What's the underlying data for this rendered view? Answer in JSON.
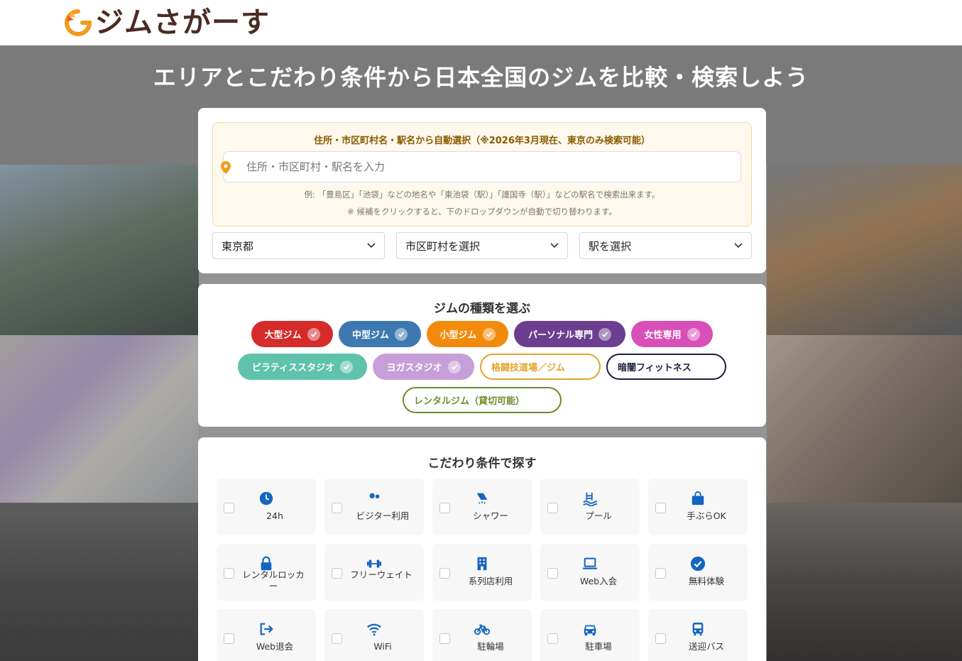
{
  "header": {
    "logo_text": "ジムさがーす"
  },
  "hero": {
    "title": "エリアとこだわり条件から日本全国のジムを比較・検索しよう"
  },
  "search": {
    "auto_title": "住所・市区町村名・駅名から自動選択（※2026年3月現在、東京のみ検索可能）",
    "input_placeholder": "住所・市区町村・駅名を入力",
    "note1": "例: 「豊島区」「池袋」などの地名や「東池袋（駅）」「護国寺（駅）」などの駅名で検索出来ます。",
    "note2": "※ 候補をクリックすると、下のドロップダウンが自動で切り替わります。",
    "prefecture": "東京都",
    "city": "市区町村を選択",
    "station": "駅を選択"
  },
  "types": {
    "title": "ジムの種類を選ぶ",
    "chips": [
      {
        "label": "大型ジム",
        "color": "#d62b2b",
        "checked": true
      },
      {
        "label": "中型ジム",
        "color": "#3d79b0",
        "checked": true
      },
      {
        "label": "小型ジム",
        "color": "#f28a0c",
        "checked": true
      },
      {
        "label": "パーソナル専門",
        "color": "#6c3e8f",
        "checked": true
      },
      {
        "label": "女性専用",
        "color": "#d94fb8",
        "checked": true
      },
      {
        "label": "ピラティススタジオ",
        "color": "#5ec3aa",
        "checked": true
      },
      {
        "label": "ヨガスタジオ",
        "color": "#c79fd8",
        "checked": true
      },
      {
        "label": "格闘技道場／ジム",
        "color": "#e3a42a",
        "checked": false
      },
      {
        "label": "暗闇フィットネス",
        "color": "#1c1f3a",
        "checked": false
      },
      {
        "label": "レンタルジム（貸切可能）",
        "color": "#6e8a2c",
        "checked": false
      }
    ]
  },
  "conditions": {
    "title": "こだわり条件で探す",
    "icon_color": "#1565c0",
    "items": [
      {
        "label": "24h",
        "icon": "clock-icon"
      },
      {
        "label": "ビジター利用",
        "icon": "users-icon"
      },
      {
        "label": "シャワー",
        "icon": "shower-icon"
      },
      {
        "label": "プール",
        "icon": "pool-icon"
      },
      {
        "label": "手ぶらOK",
        "icon": "bag-icon"
      },
      {
        "label": "レンタルロッカー",
        "icon": "lock-icon"
      },
      {
        "label": "フリーウェイト",
        "icon": "dumbbell-icon"
      },
      {
        "label": "系列店利用",
        "icon": "building-icon"
      },
      {
        "label": "Web入会",
        "icon": "laptop-icon"
      },
      {
        "label": "無料体験",
        "icon": "check-circle-icon"
      },
      {
        "label": "Web退会",
        "icon": "logout-icon"
      },
      {
        "label": "WiFi",
        "icon": "wifi-icon"
      },
      {
        "label": "駐輪場",
        "icon": "bicycle-icon"
      },
      {
        "label": "駐車場",
        "icon": "car-icon"
      },
      {
        "label": "送迎バス",
        "icon": "bus-icon"
      }
    ]
  }
}
